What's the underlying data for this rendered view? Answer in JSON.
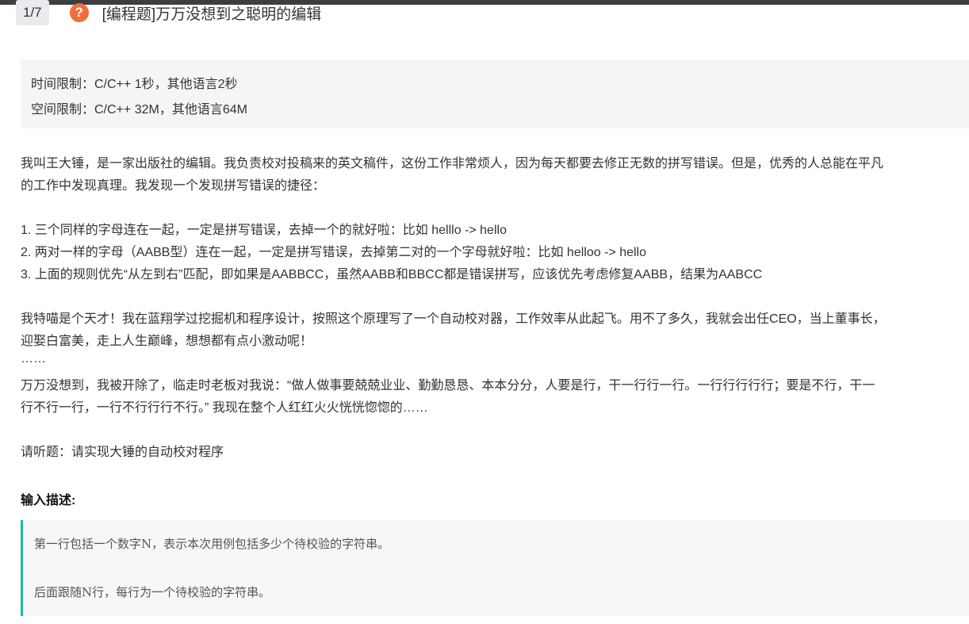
{
  "header": {
    "counter": "1/7",
    "help_icon": "?",
    "title": "[编程题]万万没想到之聪明的编辑"
  },
  "limits": {
    "time": "时间限制：C/C++ 1秒，其他语言2秒",
    "space": "空间限制：C/C++ 32M，其他语言64M"
  },
  "description": {
    "intro_line1": "我叫王大锤，是一家出版社的编辑。我负责校对投稿来的英文稿件，这份工作非常烦人，因为每天都要去修正无数的拼写错误。但是，优秀的人总能在平凡",
    "intro_line2": "的工作中发现真理。我发现一个发现拼写错误的捷径：",
    "rule1": "1. 三个同样的字母连在一起，一定是拼写错误，去掉一个的就好啦：比如 helllo -> hello",
    "rule2": "2. 两对一样的字母（AABB型）连在一起，一定是拼写错误，去掉第二对的一个字母就好啦：比如 helloo -> hello",
    "rule3": "3. 上面的规则优先“从左到右”匹配，即如果是AABBCC，虽然AABB和BBCC都是错误拼写，应该优先考虑修复AABB，结果为AABCC",
    "genius_line1": "我特喵是个天才！我在蓝翔学过挖掘机和程序设计，按照这个原理写了一个自动校对器，工作效率从此起飞。用不了多久，我就会出任CEO，当上董事长，",
    "genius_line2": "迎娶白富美，走上人生巅峰，想想都有点小激动呢！",
    "ellipsis": "……",
    "fired_line1": "万万没想到，我被开除了，临走时老板对我说：“做人做事要兢兢业业、勤勤恳恳、本本分分，人要是行，干一行行一行。一行行行行行；要是不行，干一",
    "fired_line2": "行不行一行，一行不行行行不行。” 我现在整个人红红火火恍恍惚惚的……",
    "request": "请听题：请实现大锤的自动校对程序"
  },
  "input_section": {
    "label": "输入描述:",
    "line1": "第一行包括一个数字N，表示本次用例包括多少个待校验的字符串。",
    "line2": "后面跟随N行，每行为一个待校验的字符串。"
  },
  "colors": {
    "topbar": "#3b3f44",
    "help_icon_bg": "#f26d3d",
    "quote_accent": "#1abc9c"
  }
}
